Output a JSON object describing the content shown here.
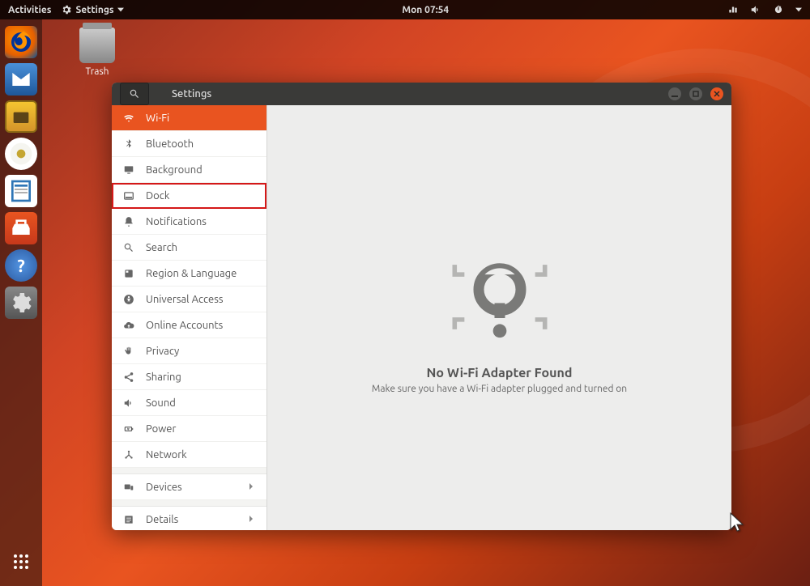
{
  "topbar": {
    "activities": "Activities",
    "app_menu": "Settings",
    "clock": "Mon 07:54"
  },
  "desktop": {
    "trash_label": "Trash"
  },
  "window": {
    "title": "Settings",
    "sidebar": [
      {
        "id": "wifi",
        "label": "Wi-Fi",
        "icon": "wifi",
        "active": true
      },
      {
        "id": "bluetooth",
        "label": "Bluetooth",
        "icon": "bluetooth"
      },
      {
        "id": "background",
        "label": "Background",
        "icon": "desktop"
      },
      {
        "id": "dock",
        "label": "Dock",
        "icon": "dock",
        "highlighted": true
      },
      {
        "id": "notifications",
        "label": "Notifications",
        "icon": "bell"
      },
      {
        "id": "search",
        "label": "Search",
        "icon": "search"
      },
      {
        "id": "region",
        "label": "Region & Language",
        "icon": "globe"
      },
      {
        "id": "access",
        "label": "Universal Access",
        "icon": "accessibility"
      },
      {
        "id": "online",
        "label": "Online Accounts",
        "icon": "cloud"
      },
      {
        "id": "privacy",
        "label": "Privacy",
        "icon": "hand"
      },
      {
        "id": "sharing",
        "label": "Sharing",
        "icon": "share"
      },
      {
        "id": "sound",
        "label": "Sound",
        "icon": "speaker"
      },
      {
        "id": "power",
        "label": "Power",
        "icon": "battery"
      },
      {
        "id": "network",
        "label": "Network",
        "icon": "network"
      },
      {
        "id": "devices",
        "label": "Devices",
        "icon": "devices",
        "arrow": true,
        "sep_before": true
      },
      {
        "id": "details",
        "label": "Details",
        "icon": "details",
        "arrow": true,
        "sep_before": true
      }
    ],
    "content": {
      "title": "No Wi-Fi Adapter Found",
      "subtitle": "Make sure you have a Wi-Fi adapter plugged and turned on"
    }
  }
}
